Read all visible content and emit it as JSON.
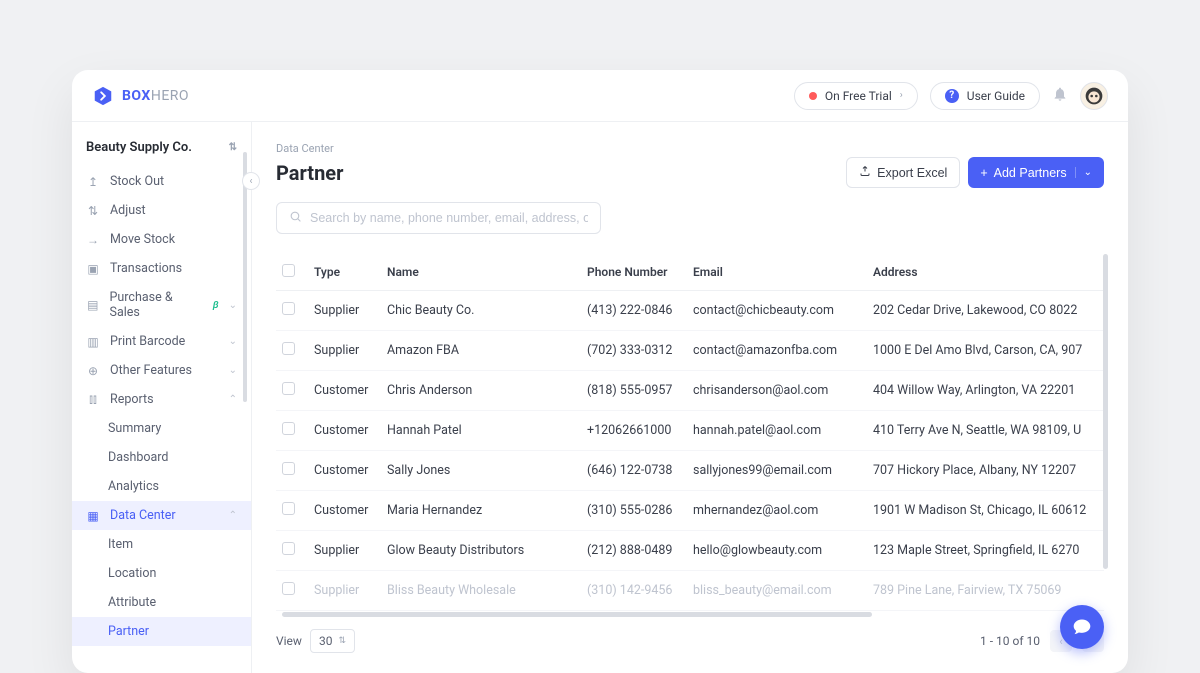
{
  "brand": {
    "bold": "BOX",
    "light": "HERO"
  },
  "topbar": {
    "trial_label": "On Free Trial",
    "guide_label": "User Guide"
  },
  "team": {
    "name": "Beauty Supply Co."
  },
  "nav": {
    "stock_out": "Stock Out",
    "adjust": "Adjust",
    "move_stock": "Move Stock",
    "transactions": "Transactions",
    "purchase_sales": "Purchase & Sales",
    "purchase_sales_badge": "β",
    "print_barcode": "Print Barcode",
    "other_features": "Other Features",
    "reports": "Reports",
    "summary": "Summary",
    "dashboard": "Dashboard",
    "analytics": "Analytics",
    "data_center": "Data Center",
    "item": "Item",
    "location": "Location",
    "attribute": "Attribute",
    "partner": "Partner"
  },
  "page": {
    "breadcrumb": "Data Center",
    "title": "Partner",
    "export_label": "Export Excel",
    "add_label": "Add Partners"
  },
  "search": {
    "placeholder": "Search by name, phone number, email, address, or memo"
  },
  "columns": {
    "type": "Type",
    "name": "Name",
    "phone": "Phone Number",
    "email": "Email",
    "address": "Address"
  },
  "rows": [
    {
      "type": "Supplier",
      "name": "Chic Beauty Co.",
      "phone": "(413) 222-0846",
      "email": "contact@chicbeauty.com",
      "address": "202 Cedar Drive, Lakewood, CO 8022"
    },
    {
      "type": "Supplier",
      "name": "Amazon FBA",
      "phone": "(702) 333-0312",
      "email": "contact@amazonfba.com",
      "address": "1000 E Del Amo Blvd, Carson, CA, 907"
    },
    {
      "type": "Customer",
      "name": "Chris Anderson",
      "phone": "(818) 555-0957",
      "email": "chrisanderson@aol.com",
      "address": "404 Willow Way, Arlington, VA 22201"
    },
    {
      "type": "Customer",
      "name": "Hannah Patel",
      "phone": "+12062661000",
      "email": "hannah.patel@aol.com",
      "address": "410 Terry Ave N, Seattle, WA 98109, U"
    },
    {
      "type": "Customer",
      "name": "Sally Jones",
      "phone": "(646) 122-0738",
      "email": "sallyjones99@email.com",
      "address": "707 Hickory Place, Albany, NY 12207"
    },
    {
      "type": "Customer",
      "name": "Maria Hernandez",
      "phone": "(310) 555-0286",
      "email": "mhernandez@aol.com",
      "address": "1901 W Madison St, Chicago, IL 60612"
    },
    {
      "type": "Supplier",
      "name": "Glow Beauty Distributors",
      "phone": "(212) 888-0489",
      "email": "hello@glowbeauty.com",
      "address": "123 Maple Street, Springfield, IL 6270"
    },
    {
      "type": "Supplier",
      "name": "Bliss Beauty Wholesale",
      "phone": "(310) 142-9456",
      "email": "bliss_beauty@email.com",
      "address": "789 Pine Lane, Fairview, TX 75069"
    }
  ],
  "footer": {
    "view_label": "View",
    "view_value": "30",
    "range": "1 - 10 of 10"
  }
}
